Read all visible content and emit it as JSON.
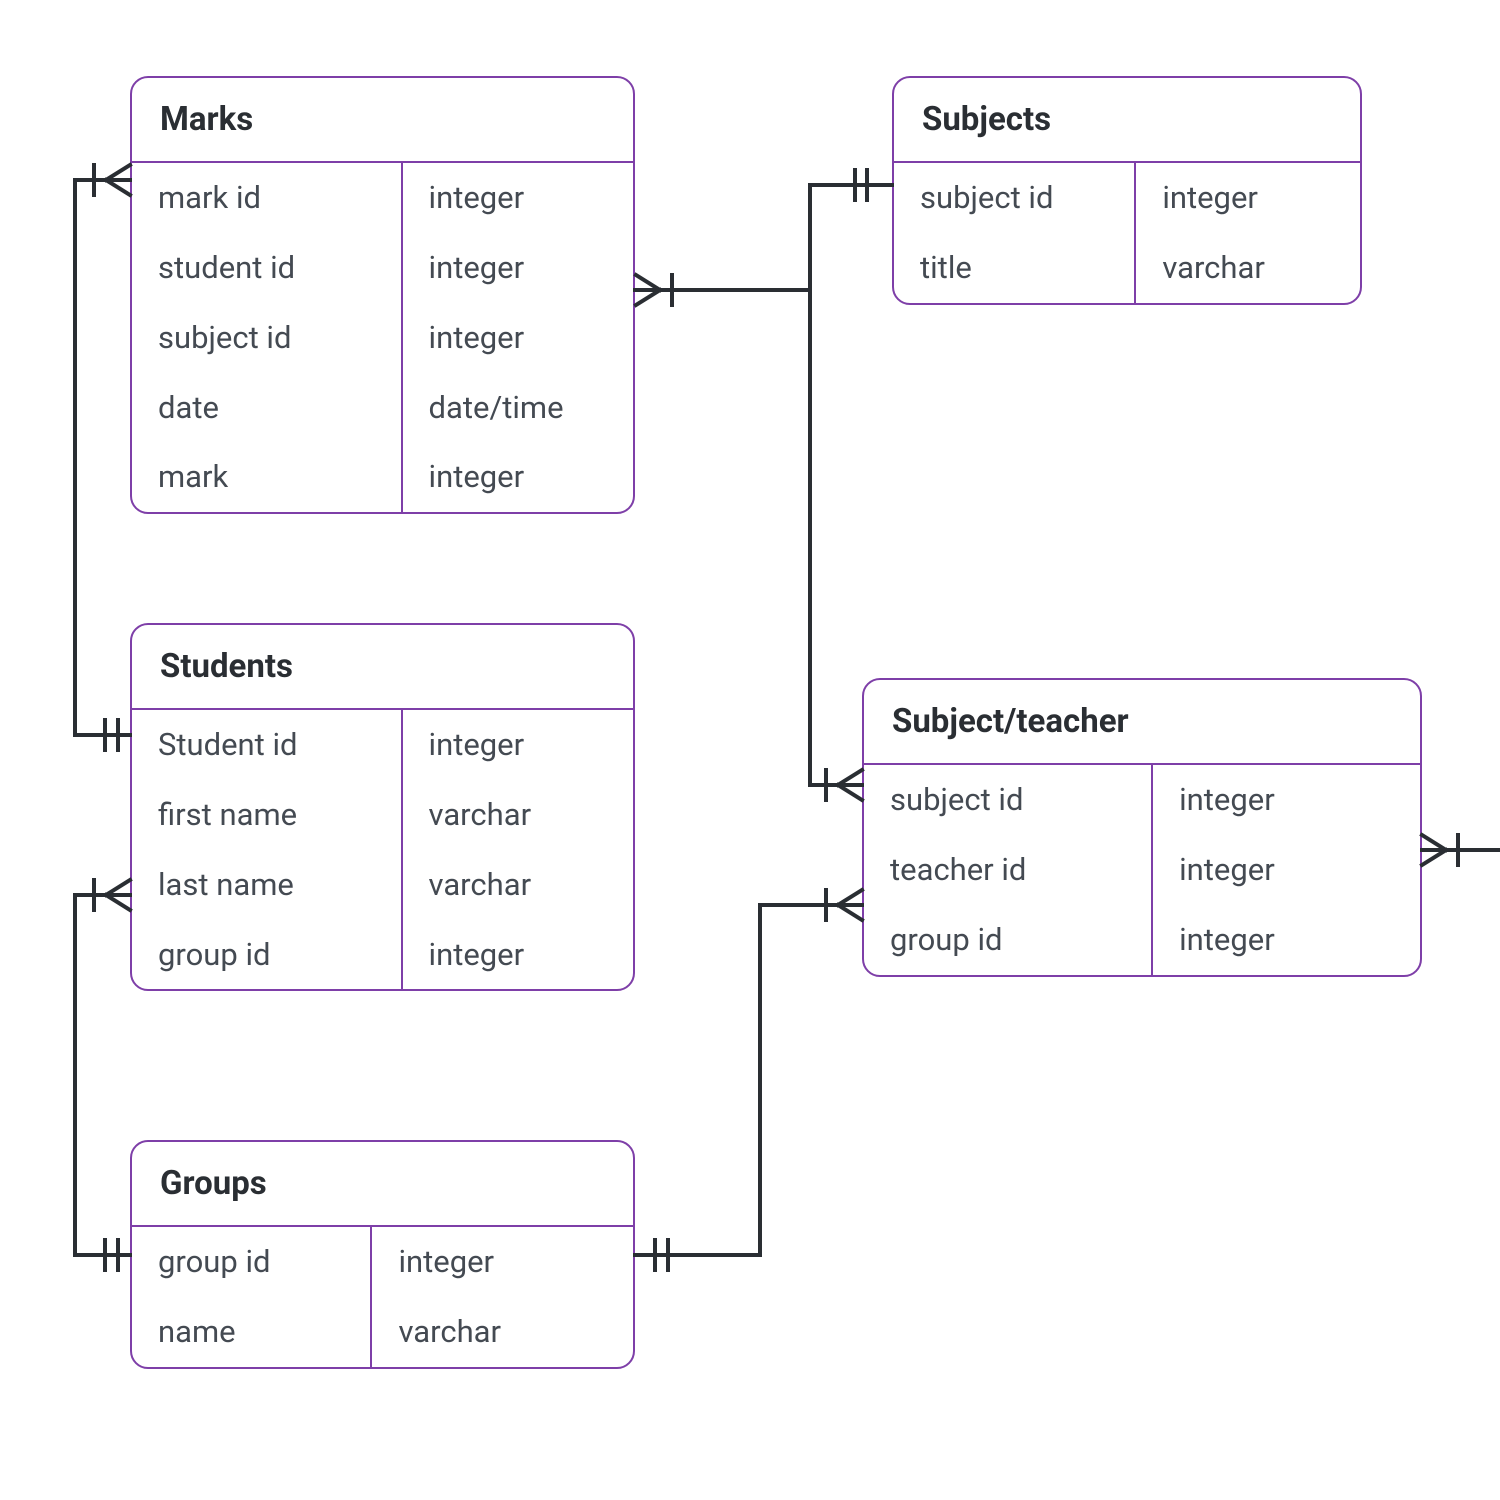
{
  "colors": {
    "entity_border": "#7e3fa8",
    "text_heading": "#2a2e33",
    "text_body": "#444a52",
    "connector": "#2a2e33",
    "background": "#ffffff"
  },
  "entities": {
    "marks": {
      "title": "Marks",
      "fields": [
        {
          "name": "mark id",
          "type": "integer"
        },
        {
          "name": "student id",
          "type": "integer"
        },
        {
          "name": "subject id",
          "type": "integer"
        },
        {
          "name": "date",
          "type": "date/time"
        },
        {
          "name": "mark",
          "type": "integer"
        }
      ]
    },
    "subjects": {
      "title": "Subjects",
      "fields": [
        {
          "name": "subject id",
          "type": "integer"
        },
        {
          "name": "title",
          "type": "varchar"
        }
      ]
    },
    "students": {
      "title": "Students",
      "fields": [
        {
          "name": "Student id",
          "type": "integer"
        },
        {
          "name": "first name",
          "type": "varchar"
        },
        {
          "name": "last name",
          "type": "varchar"
        },
        {
          "name": "group id",
          "type": "integer"
        }
      ]
    },
    "subject_teacher": {
      "title": "Subject/teacher",
      "fields": [
        {
          "name": "subject id",
          "type": "integer"
        },
        {
          "name": "teacher id",
          "type": "integer"
        },
        {
          "name": "group id",
          "type": "integer"
        }
      ]
    },
    "groups": {
      "title": "Groups",
      "fields": [
        {
          "name": "group id",
          "type": "integer"
        },
        {
          "name": "name",
          "type": "varchar"
        }
      ]
    }
  },
  "relationships": [
    {
      "from": "students",
      "to": "marks",
      "type": "one-to-many"
    },
    {
      "from": "subjects",
      "to": "marks",
      "type": "one-to-many"
    },
    {
      "from": "subjects",
      "to": "subject_teacher",
      "type": "one-to-many"
    },
    {
      "from": "groups",
      "to": "students",
      "type": "one-to-many"
    },
    {
      "from": "groups",
      "to": "subject_teacher",
      "type": "one-to-many"
    },
    {
      "from": "(external)",
      "to": "subject_teacher",
      "type": "one-to-many"
    }
  ]
}
